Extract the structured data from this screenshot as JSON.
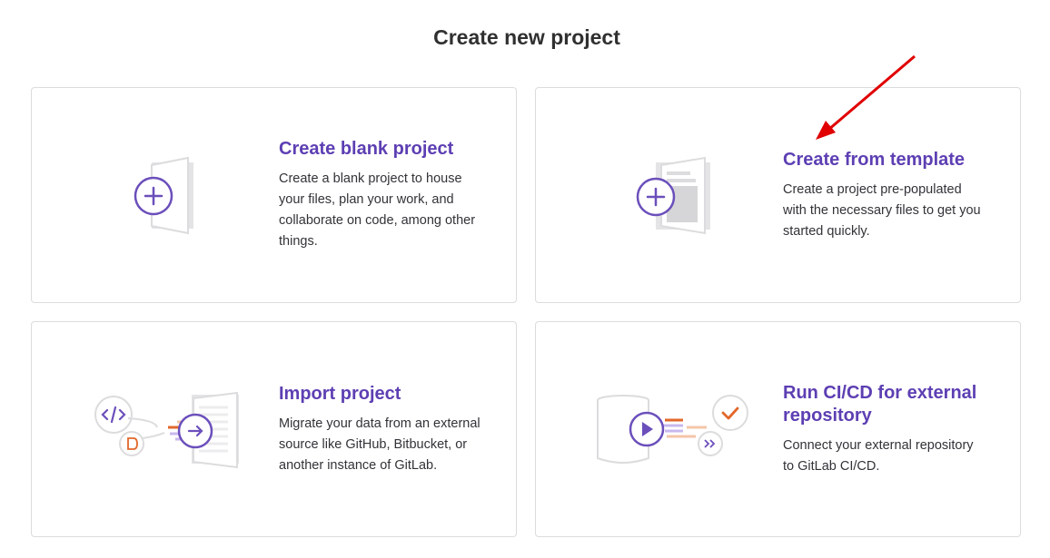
{
  "page": {
    "title": "Create new project"
  },
  "cards": [
    {
      "id": "blank",
      "title": "Create blank project",
      "description": "Create a blank project to house your files, plan your work, and collaborate on code, among other things.",
      "icon": "blank-project-illustration-icon"
    },
    {
      "id": "template",
      "title": "Create from template",
      "description": "Create a project pre-populated with the necessary files to get you started quickly.",
      "icon": "template-project-illustration-icon"
    },
    {
      "id": "import",
      "title": "Import project",
      "description": "Migrate your data from an external source like GitHub, Bitbucket, or another instance of GitLab.",
      "icon": "import-project-illustration-icon"
    },
    {
      "id": "cicd",
      "title": "Run CI/CD for external repository",
      "description": "Connect your external repository to GitLab CI/CD.",
      "icon": "cicd-external-repo-illustration-icon"
    }
  ],
  "annotation": {
    "type": "arrow",
    "points_to": "Create from template",
    "color": "#e00000"
  },
  "colors": {
    "accent": "#5d3fb3",
    "orange": "#e2672a",
    "border": "#dcdcde"
  }
}
